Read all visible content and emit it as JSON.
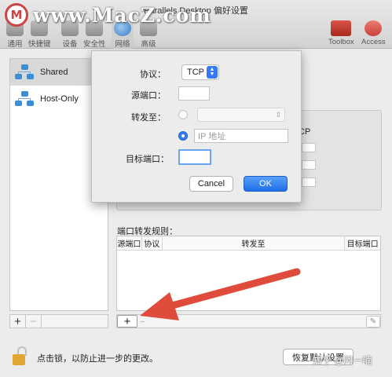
{
  "window": {
    "title": "Parallels Desktop 偏好设置"
  },
  "watermark": {
    "logo": "M",
    "text": "www.MacZ.com"
  },
  "toolbar": {
    "items": [
      {
        "label": "通用",
        "icon": "general-icon"
      },
      {
        "label": "快捷键",
        "icon": "shortcuts-icon"
      },
      {
        "label": "设备",
        "icon": "devices-icon"
      },
      {
        "label": "安全性",
        "icon": "security-icon"
      },
      {
        "label": "网络",
        "icon": "network-icon",
        "active": true
      },
      {
        "label": "高级",
        "icon": "advanced-icon"
      }
    ],
    "right_items": [
      {
        "label": "Toolbox",
        "icon": "toolbox-icon",
        "color": "#c0392b"
      },
      {
        "label": "Access",
        "icon": "access-icon",
        "color": "#d65050"
      }
    ]
  },
  "network_list": {
    "items": [
      {
        "label": "Shared",
        "selected": true,
        "icon": "network-shared-icon"
      },
      {
        "label": "Host-Only",
        "selected": false,
        "icon": "network-hostonly-icon"
      }
    ],
    "add_label": "+",
    "remove_label": "−"
  },
  "side_panel": {
    "tcp_fragment": "CP"
  },
  "port_rules": {
    "title": "端口转发规则：",
    "columns": [
      "源端口",
      "协议",
      "转发至",
      "目标端口"
    ],
    "rows": [],
    "add_label": "+",
    "remove_label": "−",
    "edit_icon": "pencil-icon"
  },
  "sheet": {
    "protocol_label": "协议：",
    "protocol_value": "TCP",
    "source_port_label": "源端口：",
    "source_port_value": "",
    "forward_to_label": "转发至：",
    "forward_to_option1_value": "",
    "ip_placeholder": "IP 地址",
    "target_port_label": "目标端口：",
    "target_port_value": "",
    "cancel_label": "Cancel",
    "ok_label": "OK"
  },
  "footer": {
    "lock_text": "点击锁，以防止进一步的更改。",
    "restore_label": "恢复默认设置",
    "zhihu_watermark": "知乎 @阿一喃"
  },
  "colors": {
    "accent": "#3478f6",
    "arrow": "#e04c3c",
    "lock": "#e1a632"
  }
}
